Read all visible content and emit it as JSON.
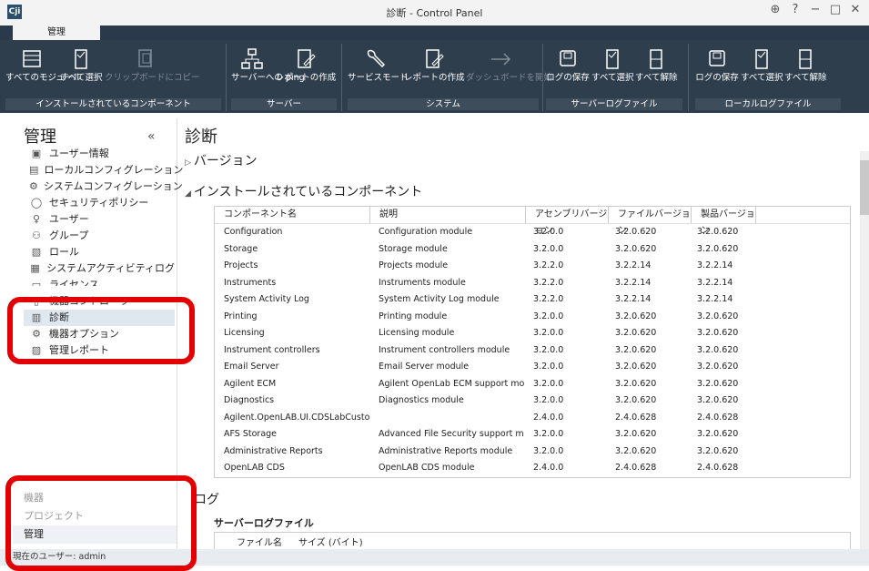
{
  "window": {
    "title": "診断 - Control Panel",
    "app_icon": "Cji",
    "controls": [
      "⊕",
      "?",
      "−",
      "□",
      "✕"
    ]
  },
  "tab": {
    "label": "管理"
  },
  "ribbon": {
    "groups": [
      {
        "label": "インストールされているコンポーネント",
        "buttons": [
          {
            "label": "すべてのモジュール",
            "icon": "list-icon"
          },
          {
            "label": "すべて選択",
            "icon": "select-all-icon"
          },
          {
            "label": "クリップボードにコピー",
            "icon": "copy-icon",
            "disabled": true
          }
        ]
      },
      {
        "label": "サーバー",
        "buttons": [
          {
            "label": "サーバーへの ping",
            "icon": "network-icon"
          },
          {
            "label": "レポートの作成",
            "icon": "report-icon"
          }
        ]
      },
      {
        "label": "システム",
        "buttons": [
          {
            "label": "サービスモード",
            "icon": "wrench-icon"
          },
          {
            "label": "レポートの作成",
            "icon": "report-icon"
          },
          {
            "label": "ダッシュボードを開始",
            "icon": "arrow-right-icon",
            "disabled": true
          }
        ]
      },
      {
        "label": "サーバーログファイル",
        "buttons": [
          {
            "label": "ログの保存",
            "icon": "save-icon"
          },
          {
            "label": "すべて選択",
            "icon": "select-all-icon"
          },
          {
            "label": "すべて解除",
            "icon": "deselect-all-icon"
          }
        ]
      },
      {
        "label": "ローカルログファイル",
        "buttons": [
          {
            "label": "ログの保存",
            "icon": "save-icon"
          },
          {
            "label": "すべて選択",
            "icon": "select-all-icon"
          },
          {
            "label": "すべて解除",
            "icon": "deselect-all-icon"
          }
        ]
      }
    ]
  },
  "sidebar": {
    "title": "管理",
    "collapse": "«",
    "items": [
      {
        "label": "ユーザー情報",
        "icon": "user-info-icon"
      },
      {
        "label": "ローカルコンフィグレーション",
        "icon": "config-icon"
      },
      {
        "label": "システムコンフィグレーション",
        "icon": "gear-icon"
      },
      {
        "label": "セキュリティポリシー",
        "icon": "shield-icon"
      },
      {
        "label": "ユーザー",
        "icon": "user-icon"
      },
      {
        "label": "グループ",
        "icon": "group-icon"
      },
      {
        "label": "ロール",
        "icon": "role-icon"
      },
      {
        "label": "システムアクティビティログ",
        "icon": "log-icon"
      },
      {
        "label": "ライセンス",
        "icon": "license-icon"
      },
      {
        "label": "機器コントローラ",
        "icon": "controller-icon"
      },
      {
        "label": "診断",
        "icon": "diagnostics-icon"
      },
      {
        "label": "機器オプション",
        "icon": "options-icon"
      },
      {
        "label": "管理レポート",
        "icon": "admin-report-icon"
      }
    ],
    "bottom": [
      "機器",
      "プロジェクト",
      "管理"
    ]
  },
  "status": {
    "text": "現在のユーザー: admin"
  },
  "main": {
    "title": "診断",
    "version_section": "バージョン",
    "components_section": "インストールされているコンポーネント",
    "columns": [
      "コンポーネント名",
      "説明",
      "アセンブリバージョン",
      "ファイルバージョン",
      "製品バージョン"
    ],
    "rows": [
      [
        "Configuration",
        "Configuration module",
        "3.2.0.0",
        "3.2.0.620",
        "3.2.0.620"
      ],
      [
        "Storage",
        "Storage module",
        "3.2.0.0",
        "3.2.0.620",
        "3.2.0.620"
      ],
      [
        "Projects",
        "Projects module",
        "3.2.2.0",
        "3.2.2.14",
        "3.2.2.14"
      ],
      [
        "Instruments",
        "Instruments module",
        "3.2.2.0",
        "3.2.2.14",
        "3.2.2.14"
      ],
      [
        "System Activity Log",
        "System Activity Log module",
        "3.2.2.0",
        "3.2.2.14",
        "3.2.2.14"
      ],
      [
        "Printing",
        "Printing module",
        "3.2.0.0",
        "3.2.0.620",
        "3.2.0.620"
      ],
      [
        "Licensing",
        "Licensing module",
        "3.2.0.0",
        "3.2.0.620",
        "3.2.0.620"
      ],
      [
        "Instrument controllers",
        "Instrument controllers module",
        "3.2.0.0",
        "3.2.0.620",
        "3.2.0.620"
      ],
      [
        "Email Server",
        "Email Server module",
        "3.2.0.0",
        "3.2.0.620",
        "3.2.0.620"
      ],
      [
        "Agilent ECM",
        "Agilent OpenLab ECM support module",
        "3.2.0.0",
        "3.2.0.620",
        "3.2.0.620"
      ],
      [
        "Diagnostics",
        "Diagnostics module",
        "3.2.0.0",
        "3.2.0.620",
        "3.2.0.620"
      ],
      [
        "Agilent.OpenLAB.UI.CDSLabCustomFit",
        "",
        "2.4.0.0",
        "2.4.0.628",
        "2.4.0.628"
      ],
      [
        "AFS Storage",
        "Advanced File Security support module",
        "3.2.0.0",
        "3.2.0.620",
        "3.2.0.620"
      ],
      [
        "Administrative Reports",
        "Administrative Reports module",
        "3.2.0.0",
        "3.2.0.620",
        "3.2.0.620"
      ],
      [
        "OpenLAB CDS",
        "OpenLAB CDS module",
        "2.4.0.0",
        "2.4.0.628",
        "2.4.0.628"
      ]
    ],
    "log_section": "ログ",
    "server_log_title": "サーバーログファイル",
    "log_columns": [
      "ファイル名",
      "サイズ (バイト)"
    ]
  },
  "colors": {
    "ribbon_bg": "#2f3e4d",
    "highlight": "#e30000",
    "selected": "#dfe7ef"
  }
}
